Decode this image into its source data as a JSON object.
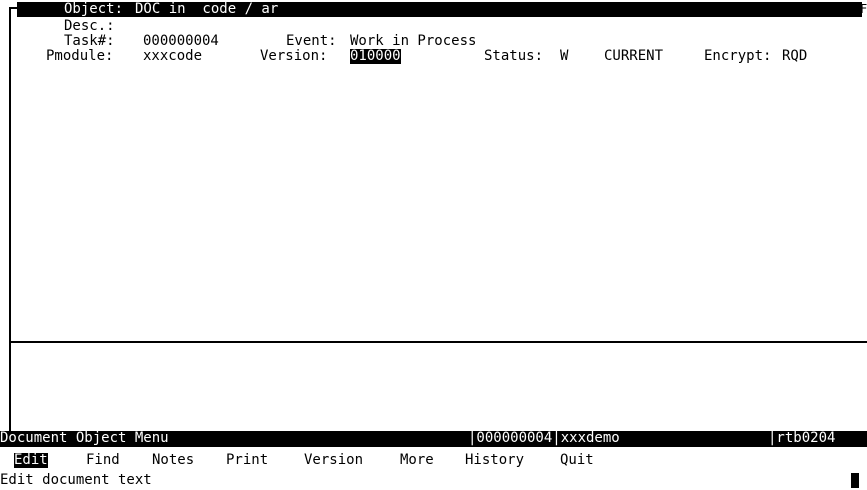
{
  "header": {
    "object_label": "Object:",
    "object_value": "DOC in  code / ar",
    "right_marker": "F"
  },
  "fields": {
    "desc_label": "Desc.:",
    "desc_value": "",
    "task_label": "Task#:",
    "task_value": "000000004",
    "event_label": "Event:",
    "event_value": "Work in Process",
    "pmodule_label": "Pmodule:",
    "pmodule_value": "xxxcode",
    "version_label": "Version:",
    "version_value": "010000",
    "status_label": "Status:",
    "status_value": "W",
    "current_label": "CURRENT",
    "encrypt_label": "Encrypt:",
    "encrypt_value": "RQD"
  },
  "status_bar": {
    "menu_title": "Document Object Menu",
    "task_ref": "|000000004|xxxdemo",
    "screen_id": "|rtb0204"
  },
  "menu": {
    "items": [
      "Edit",
      "Find",
      "Notes",
      "Print",
      "Version",
      "More",
      "History",
      "Quit"
    ],
    "selected": "Edit"
  },
  "help_text": "Edit document text"
}
